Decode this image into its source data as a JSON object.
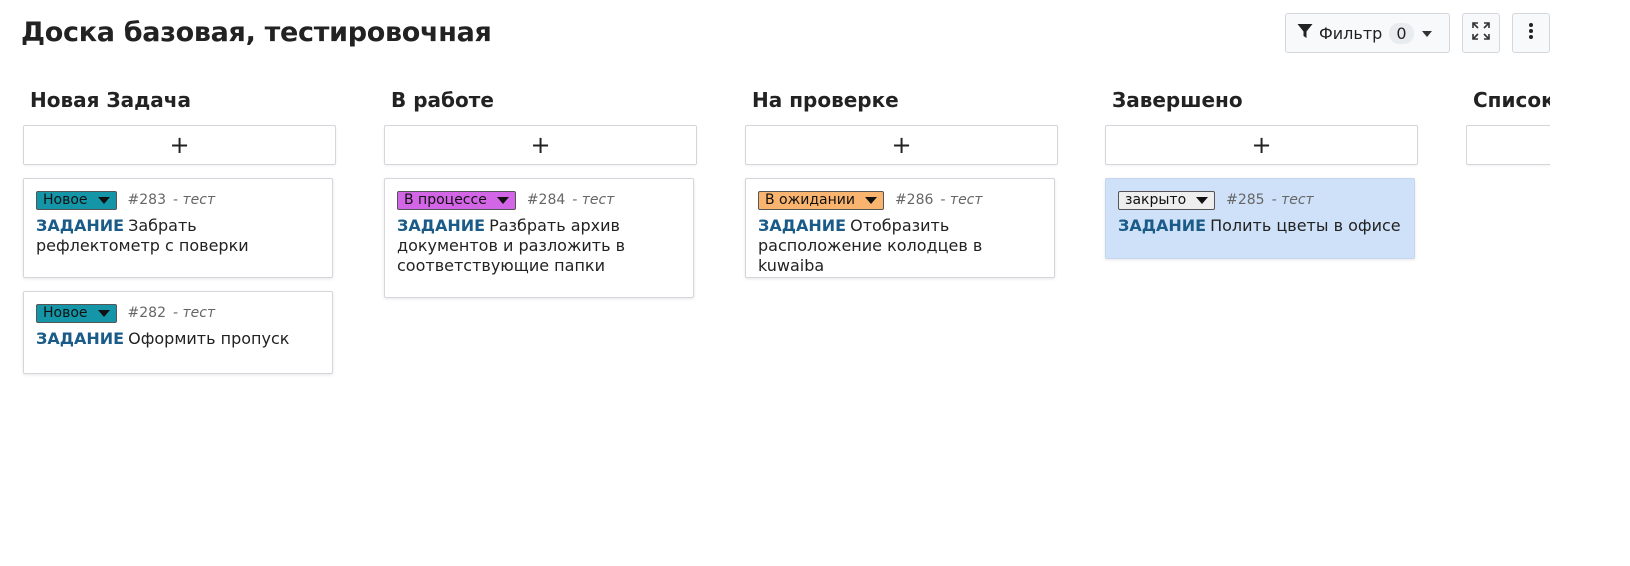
{
  "board": {
    "title": "Доска базовая, тестировочная"
  },
  "toolbar": {
    "filter_label": "Фильтр",
    "filter_count": "0"
  },
  "add_label": "+",
  "columns": [
    {
      "title": "Новая Задача",
      "cards": [
        {
          "status": "Новое",
          "status_color": "#1596a8",
          "id": "#283",
          "author": "- тест",
          "type": "ЗАДАНИЕ",
          "text": "Забрать рефлектометр с поверки"
        },
        {
          "status": "Новое",
          "status_color": "#1596a8",
          "id": "#282",
          "author": "- тест",
          "type": "ЗАДАНИЕ",
          "text": "Оформить пропуск"
        }
      ]
    },
    {
      "title": "В работе",
      "cards": [
        {
          "status": "В процессе",
          "status_color": "#d366e6",
          "id": "#284",
          "author": "- тест",
          "type": "ЗАДАНИЕ",
          "text": "Разбрать архив документов и разложить в соответствующие папки"
        }
      ]
    },
    {
      "title": "На проверке",
      "cards": [
        {
          "status": "В ожидании",
          "status_color": "#f9b46f",
          "id": "#286",
          "author": "- тест",
          "type": "ЗАДАНИЕ",
          "text": "Отобразить расположение колодцев в kuwaiba"
        }
      ]
    },
    {
      "title": "Завершено",
      "cards": [
        {
          "status": "закрыто",
          "status_color": "#eeeeee",
          "id": "#285",
          "author": "- тест",
          "type": "ЗАДАНИЕ",
          "text": "Полить цветы в офисе"
        }
      ]
    },
    {
      "title": "Список",
      "cards": []
    }
  ],
  "icons": {
    "filter": "funnel-icon",
    "expand": "expand-icon",
    "more": "vertical-dots-icon"
  },
  "colors": {
    "card_closed_bg": "#cfe1f8",
    "task_type": "#1b5b88"
  }
}
